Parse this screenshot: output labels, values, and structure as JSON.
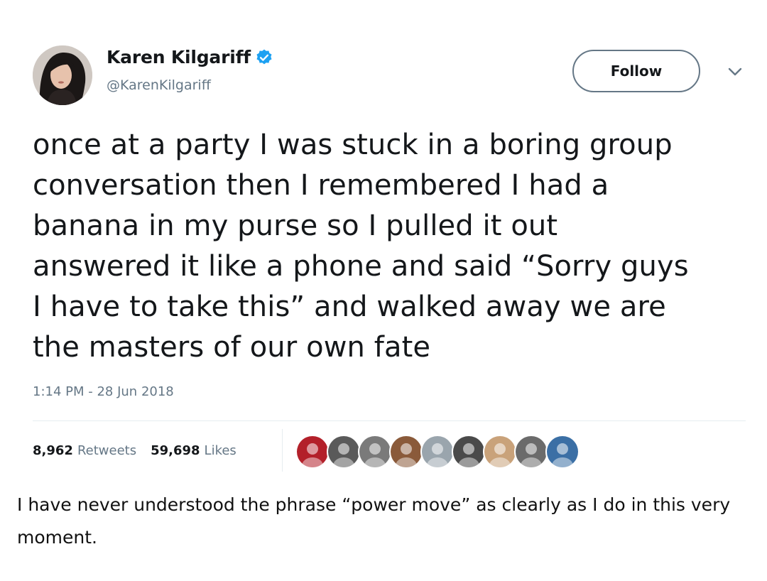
{
  "tweet": {
    "author": {
      "display_name": "Karen Kilgariff",
      "handle": "@KarenKilgariff",
      "verified": true,
      "avatar_icon": "profile-photo"
    },
    "follow_label": "Follow",
    "menu_icon": "chevron-down-icon",
    "text_lines": [
      "once at a party I was stuck in a boring group",
      "conversation then I remembered I had a",
      "banana in my purse so I pulled it out",
      "answered it like a phone and said “Sorry guys",
      "I have to take this” and walked away we are",
      "the masters of our own fate"
    ],
    "timestamp": "1:14 PM - 28 Jun 2018",
    "retweets": {
      "count": "8,962",
      "label": "Retweets"
    },
    "likes": {
      "count": "59,698",
      "label": "Likes"
    },
    "likers": [
      {
        "name": "liker-avatar-1",
        "color": "#b3202a"
      },
      {
        "name": "liker-avatar-2",
        "color": "#5a5a5a"
      },
      {
        "name": "liker-avatar-3",
        "color": "#7a7a7a"
      },
      {
        "name": "liker-avatar-4",
        "color": "#8a5a3a"
      },
      {
        "name": "liker-avatar-5",
        "color": "#9aa5ad"
      },
      {
        "name": "liker-avatar-6",
        "color": "#4a4a4a"
      },
      {
        "name": "liker-avatar-7",
        "color": "#c9a27a"
      },
      {
        "name": "liker-avatar-8",
        "color": "#6b6b6b"
      },
      {
        "name": "liker-avatar-9",
        "color": "#3b6fa5"
      }
    ]
  },
  "caption": {
    "text": "I have never understood the phrase “power move” as clearly as I do in this very moment."
  },
  "colors": {
    "text": "#14171a",
    "muted": "#657786",
    "verified": "#1da1f2",
    "divider": "#e6ecf0"
  }
}
